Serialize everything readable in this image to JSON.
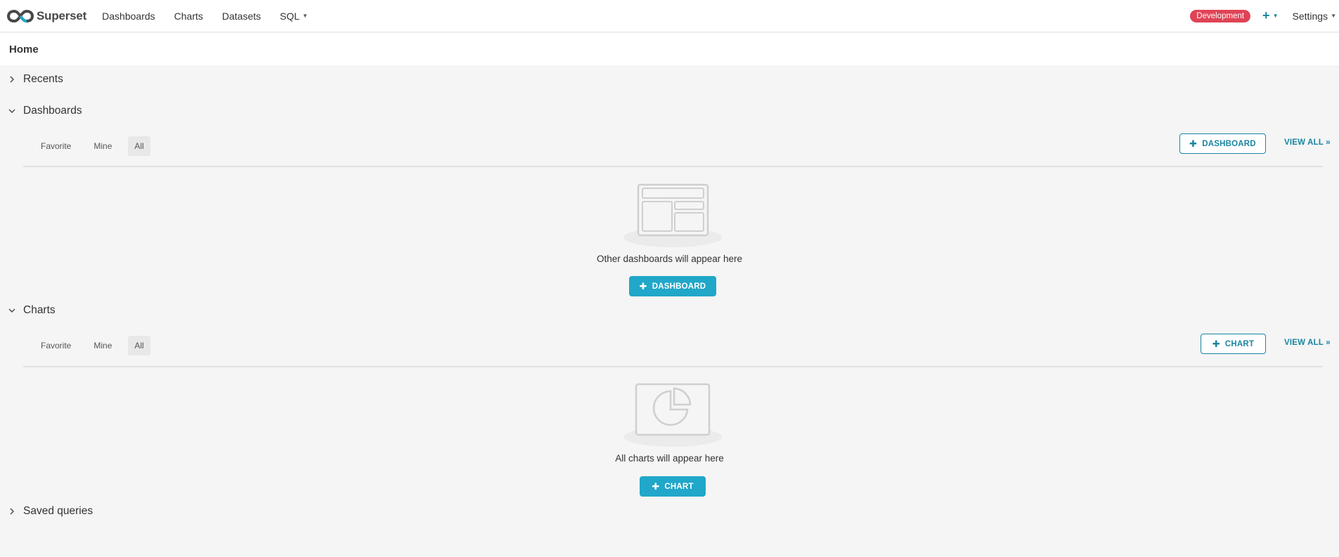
{
  "app": {
    "brand": "Superset",
    "nav": [
      {
        "label": "Dashboards"
      },
      {
        "label": "Charts"
      },
      {
        "label": "Datasets"
      },
      {
        "label": "SQL"
      }
    ],
    "environment_badge": "Development",
    "plus_symbol": "+",
    "settings_label": "Settings"
  },
  "page": {
    "title": "Home"
  },
  "sections": {
    "recents": {
      "title": "Recents"
    },
    "dashboards": {
      "title": "Dashboards",
      "tabs": [
        "Favorite",
        "Mine",
        "All"
      ],
      "active_tab": "All",
      "add_label": "DASHBOARD",
      "view_all": "VIEW ALL »",
      "empty_text": "Other dashboards will appear here",
      "empty_button": "DASHBOARD"
    },
    "charts": {
      "title": "Charts",
      "tabs": [
        "Favorite",
        "Mine",
        "All"
      ],
      "active_tab": "All",
      "add_label": "CHART",
      "view_all": "VIEW ALL »",
      "empty_text": "All charts will appear here",
      "empty_button": "CHART"
    },
    "saved_queries": {
      "title": "Saved queries"
    }
  },
  "colors": {
    "primary": "#20a7c9",
    "primary_dark": "#1a85a0",
    "badge": "#e04355",
    "background": "#f5f5f5"
  },
  "icons": [
    "superset-logo-icon",
    "caret-down-icon",
    "plus-icon",
    "chevron-right-icon",
    "chevron-down-icon",
    "empty-dashboard-icon",
    "empty-chart-icon"
  ]
}
